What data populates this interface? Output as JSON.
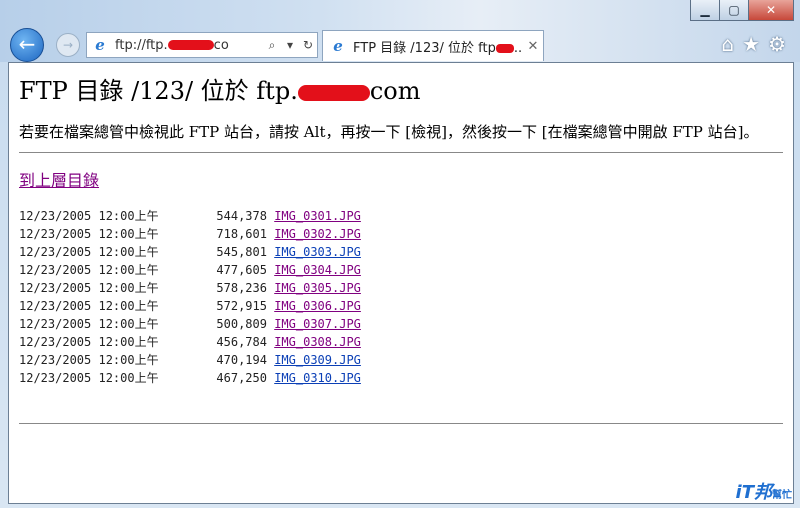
{
  "browser": {
    "address": {
      "text": "ftp://ftp.",
      "suffix": "co"
    },
    "tab": {
      "title": "FTP 目錄 /123/ 位於 ftp"
    },
    "caption": {
      "minimize": "▁",
      "maximize": "▢",
      "close": "✕"
    },
    "icons": [
      "home-icon",
      "star-icon",
      "gear-icon"
    ]
  },
  "page": {
    "title_prefix": "FTP 目錄 /123/ 位於 ftp.",
    "title_suffix": "com",
    "instructions": "若要在檔案總管中檢視此 FTP 站台，請按 Alt，再按一下 [檢視]，然後按一下 [在檔案總管中開啟 FTP 站台]。",
    "up_link": "到上層目錄",
    "files": [
      {
        "date": "12/23/2005",
        "time": "12:00上午",
        "size": "544,378",
        "name": "IMG_0301.JPG",
        "visited": true
      },
      {
        "date": "12/23/2005",
        "time": "12:00上午",
        "size": "718,601",
        "name": "IMG_0302.JPG",
        "visited": true
      },
      {
        "date": "12/23/2005",
        "time": "12:00上午",
        "size": "545,801",
        "name": "IMG_0303.JPG",
        "visited": false
      },
      {
        "date": "12/23/2005",
        "time": "12:00上午",
        "size": "477,605",
        "name": "IMG_0304.JPG",
        "visited": true
      },
      {
        "date": "12/23/2005",
        "time": "12:00上午",
        "size": "578,236",
        "name": "IMG_0305.JPG",
        "visited": true
      },
      {
        "date": "12/23/2005",
        "time": "12:00上午",
        "size": "572,915",
        "name": "IMG_0306.JPG",
        "visited": true
      },
      {
        "date": "12/23/2005",
        "time": "12:00上午",
        "size": "500,809",
        "name": "IMG_0307.JPG",
        "visited": true
      },
      {
        "date": "12/23/2005",
        "time": "12:00上午",
        "size": "456,784",
        "name": "IMG_0308.JPG",
        "visited": true
      },
      {
        "date": "12/23/2005",
        "time": "12:00上午",
        "size": "470,194",
        "name": "IMG_0309.JPG",
        "visited": false
      },
      {
        "date": "12/23/2005",
        "time": "12:00上午",
        "size": "467,250",
        "name": "IMG_0310.JPG",
        "visited": false
      }
    ]
  },
  "watermark": {
    "main": "iT邦",
    "sub": "幫忙"
  },
  "colors": {
    "visited_link": "#800080",
    "unvisited_link": "#0b3fb6",
    "redaction": "#e3101a"
  }
}
